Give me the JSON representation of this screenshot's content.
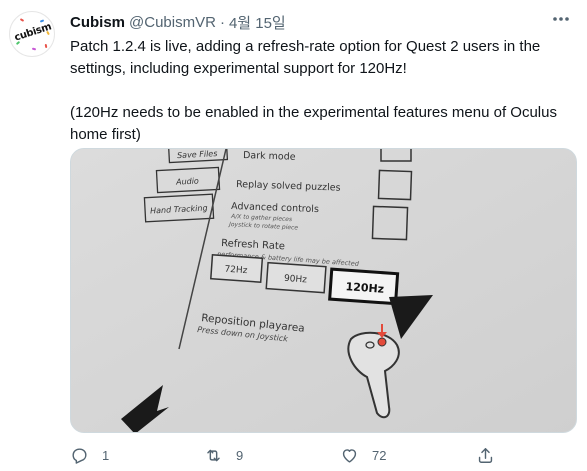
{
  "tweet": {
    "author": {
      "display_name": "Cubism",
      "handle": "@CubismVR",
      "avatar_text": "cubism"
    },
    "date": "4월 15일",
    "separator": "·",
    "more_icon": "more-horizontal-icon",
    "text": [
      "Patch 1.2.4 is live, adding a refresh-rate option for Quest 2 users in the settings, including experimental support for 120Hz!",
      "(120Hz needs to be enabled in the experimental features menu of Oculus home first)"
    ],
    "media": {
      "settings_buttons": [
        "Save Files",
        "Audio",
        "Hand Tracking"
      ],
      "options": [
        "Dark mode",
        "Replay solved puzzles",
        "Advanced controls"
      ],
      "advanced_hint_1": "A/X to gather pieces",
      "advanced_hint_2": "Joystick to rotate piece",
      "refresh_title": "Refresh Rate",
      "refresh_hint": "performance & battery life may be affected",
      "refresh_options": [
        "72Hz",
        "90Hz",
        "120Hz"
      ],
      "refresh_selected": "120Hz",
      "reposition_title": "Reposition playarea",
      "reposition_hint": "Press down on Joystick"
    },
    "actions": {
      "reply": {
        "icon": "reply-icon",
        "count": "1"
      },
      "retweet": {
        "icon": "retweet-icon",
        "count": "9"
      },
      "like": {
        "icon": "heart-icon",
        "count": "72"
      },
      "share": {
        "icon": "share-icon",
        "count": ""
      }
    }
  }
}
